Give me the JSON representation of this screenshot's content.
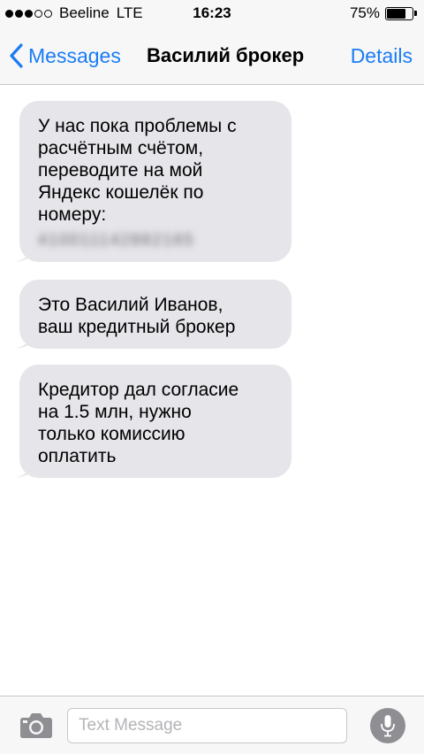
{
  "status_bar": {
    "signal_filled": 3,
    "signal_total": 5,
    "carrier": "Beeline",
    "network": "LTE",
    "time": "16:23",
    "battery_percent": "75%",
    "battery_level": 0.75
  },
  "nav": {
    "back_label": "Messages",
    "title": "Василий брокер",
    "details_label": "Details"
  },
  "messages": [
    {
      "text": "У нас пока проблемы с\nрасчётным счётом,\nпереводите на мой\nЯндекс кошелёк по\nномеру:",
      "blurred": "410011142882165"
    },
    {
      "text": "Это Василий Иванов,\nваш кредитный брокер"
    },
    {
      "text": "Кредитор дал согласие\nна 1.5 млн, нужно\nтолько комиссию\nоплатить"
    }
  ],
  "input": {
    "placeholder": "Text Message"
  },
  "colors": {
    "accent": "#1a7cf5",
    "bubble": "#e5e5ea",
    "bar": "#f7f7f7",
    "mic": "#8e8e93"
  }
}
